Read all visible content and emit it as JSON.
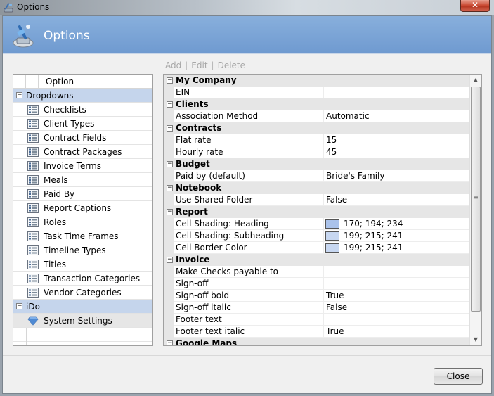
{
  "window": {
    "title": "Options",
    "close_glyph": "✕"
  },
  "header": {
    "title": "Options",
    "icon": "options-wand-icon"
  },
  "toolbar": {
    "add": "Add",
    "edit": "Edit",
    "delete": "Delete",
    "sep": "|"
  },
  "tree": {
    "column_header": "Option",
    "groups": [
      {
        "label": "Dropdowns",
        "items": [
          "Checklists",
          "Client Types",
          "Contract Fields",
          "Contract Packages",
          "Invoice Terms",
          "Meals",
          "Paid By",
          "Report Captions",
          "Roles",
          "Task Time Frames",
          "Timeline Types",
          "Titles",
          "Transaction Categories",
          "Vendor Categories"
        ]
      },
      {
        "label": "iDo",
        "items": [
          "System Settings"
        ]
      }
    ],
    "toggle_glyph": "−"
  },
  "grid": {
    "categories": [
      {
        "label": "My Company",
        "props": [
          {
            "name": "EIN",
            "value": ""
          }
        ]
      },
      {
        "label": "Clients",
        "props": [
          {
            "name": "Association Method",
            "value": "Automatic"
          }
        ]
      },
      {
        "label": "Contracts",
        "props": [
          {
            "name": "Flat rate",
            "value": "15"
          },
          {
            "name": "Hourly rate",
            "value": "45"
          }
        ]
      },
      {
        "label": "Budget",
        "props": [
          {
            "name": "Paid by (default)",
            "value": "Bride's Family"
          }
        ]
      },
      {
        "label": "Notebook",
        "props": [
          {
            "name": "Use Shared Folder",
            "value": "False"
          }
        ]
      },
      {
        "label": "Report",
        "props": [
          {
            "name": "Cell Shading: Heading",
            "value": "170; 194; 234",
            "color": "#aac2ea"
          },
          {
            "name": "Cell Shading: Subheading",
            "value": "199; 215; 241",
            "color": "#c7d7f1"
          },
          {
            "name": "Cell Border Color",
            "value": "199; 215; 241",
            "color": "#c7d7f1"
          }
        ]
      },
      {
        "label": "Invoice",
        "props": [
          {
            "name": "Make Checks payable to",
            "value": ""
          },
          {
            "name": "Sign-off",
            "value": ""
          },
          {
            "name": "Sign-off bold",
            "value": "True"
          },
          {
            "name": "Sign-off italic",
            "value": "False"
          },
          {
            "name": "Footer text",
            "value": ""
          },
          {
            "name": "Footer text italic",
            "value": "True"
          }
        ]
      },
      {
        "label": "Google Maps",
        "props": []
      }
    ]
  },
  "buttons": {
    "close": "Close"
  }
}
